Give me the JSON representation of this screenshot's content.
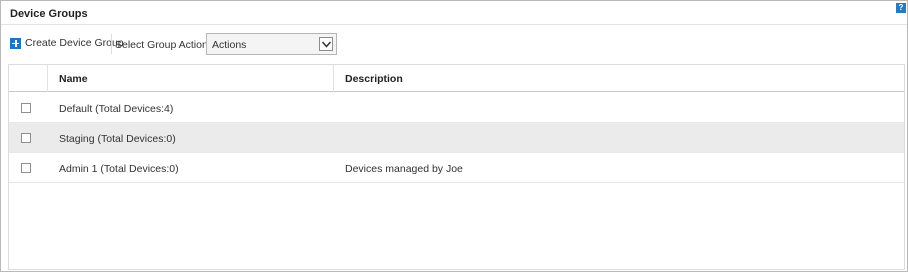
{
  "panel": {
    "title": "Device Groups",
    "help_icon": "?"
  },
  "toolbar": {
    "create_label": "Create Device Group",
    "select_label": "Select Group Actions",
    "actions_value": "Actions"
  },
  "grid": {
    "columns": [
      "Name",
      "Description"
    ],
    "rows": [
      {
        "name": "Default (Total Devices:4)",
        "description": "",
        "checked": false
      },
      {
        "name": "Staging (Total Devices:0)",
        "description": "",
        "checked": false
      },
      {
        "name": "Admin 1 (Total Devices:0)",
        "description": "Devices managed by Joe",
        "checked": false
      }
    ]
  },
  "colors": {
    "accent": "#1b76c4",
    "row_alt": "#ebebeb",
    "border": "#b9b9b9"
  }
}
